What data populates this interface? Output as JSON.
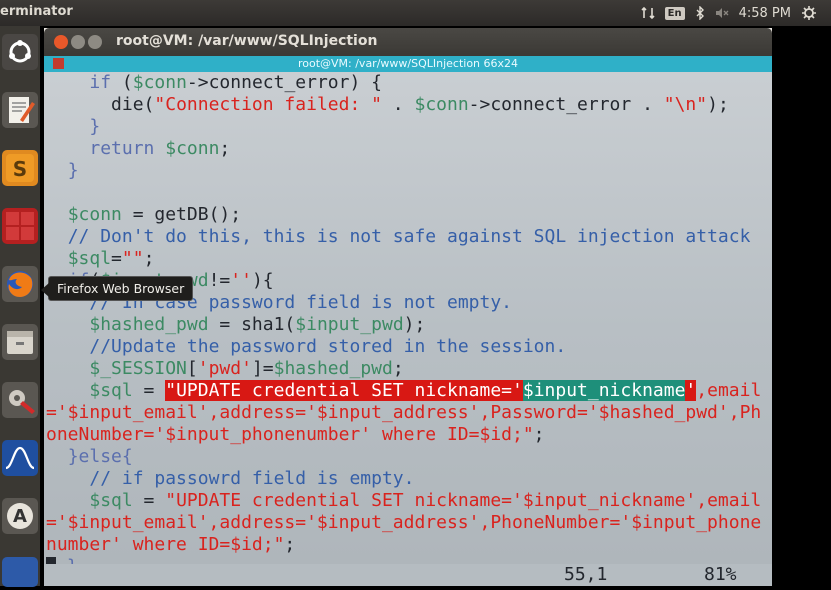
{
  "topbar": {
    "app_title": "erminator",
    "keyboard_layout": "En",
    "time": "4:58 PM"
  },
  "launcher": {
    "items": [
      {
        "icon": "ubuntu-dash-icon"
      },
      {
        "icon": "text-editor-icon"
      },
      {
        "icon": "sublime-text-icon"
      },
      {
        "icon": "terminator-icon"
      },
      {
        "icon": "firefox-icon"
      },
      {
        "icon": "files-icon"
      },
      {
        "icon": "system-settings-icon"
      },
      {
        "icon": "wireshark-icon"
      },
      {
        "icon": "software-updater-icon"
      }
    ],
    "tooltip": "Firefox Web Browser"
  },
  "window": {
    "title": "root@VM: /var/www/SQLInjection",
    "vim_label": "root@VM: /var/www/SQLInjection 66x24"
  },
  "code": {
    "l1_kw": "if",
    "l1_a": " (",
    "l1_var": "$conn",
    "l1_b": "->connect_error) {",
    "l2_fn": "die(",
    "l2_str": "\"Connection failed: \"",
    "l2_dot": " . ",
    "l2_var": "$conn",
    "l2_b": "->connect_error . ",
    "l2_str2": "\"\\n\"",
    "l2_end": ");",
    "l3": "}",
    "l4_kw": "return",
    "l4_var": "$conn",
    "l4_end": ";",
    "l5": "}",
    "l7_var": "$conn",
    "l7_rest": " = getDB();",
    "l8": "// Don't do this, this is not safe against SQL injection attack",
    "l9_var": "$sql",
    "l9_eq": "=",
    "l9_str": "\"\"",
    "l9_end": ";",
    "l10_kw": "if",
    "l10_a": "(",
    "l10_var": "$input_pwd",
    "l10_b": "!=",
    "l10_str": "''",
    "l10_c": "){",
    "l11": "// In case password field is not empty.",
    "l12_var": "$hashed_pwd",
    "l12_mid": " = sha1(",
    "l12_var2": "$input_pwd",
    "l12_end": ");",
    "l13": "//Update the password stored in the session.",
    "l14_var": "$_SESSION",
    "l14_a": "[",
    "l14_str": "'pwd'",
    "l14_b": "]=",
    "l14_var2": "$hashed_pwd",
    "l14_end": ";",
    "l15_var": "$sql",
    "l15_eq": " = ",
    "l15_hl1": "\"UPDATE credential SET nickname='",
    "l15_hlg": "$input_nickname",
    "l15_hl2": "'",
    "l15_str": ",email",
    "l16": "='$input_email',address='$input_address',Password='$hashed_pwd',Ph",
    "l17_str": "oneNumber='$input_phonenumber' where ID=$id;\"",
    "l17_end": ";",
    "l18": "}else{",
    "l19": "// if passowrd field is empty.",
    "l20_var": "$sql",
    "l20_eq": " = ",
    "l20_str": "\"UPDATE credential SET nickname='$input_nickname',email",
    "l21": "='$input_email',address='$input_address',PhoneNumber='$input_phone",
    "l22_str": "number' where ID=$id;\"",
    "l22_end": ";",
    "l23": "}"
  },
  "status": {
    "position": "55,1",
    "percent": "81%"
  },
  "colors": {
    "string": "#d9231e",
    "variable": "#3c8a63",
    "comment": "#355fa8",
    "highlight": "#d81814",
    "highlight_var": "#1e8f7a"
  }
}
